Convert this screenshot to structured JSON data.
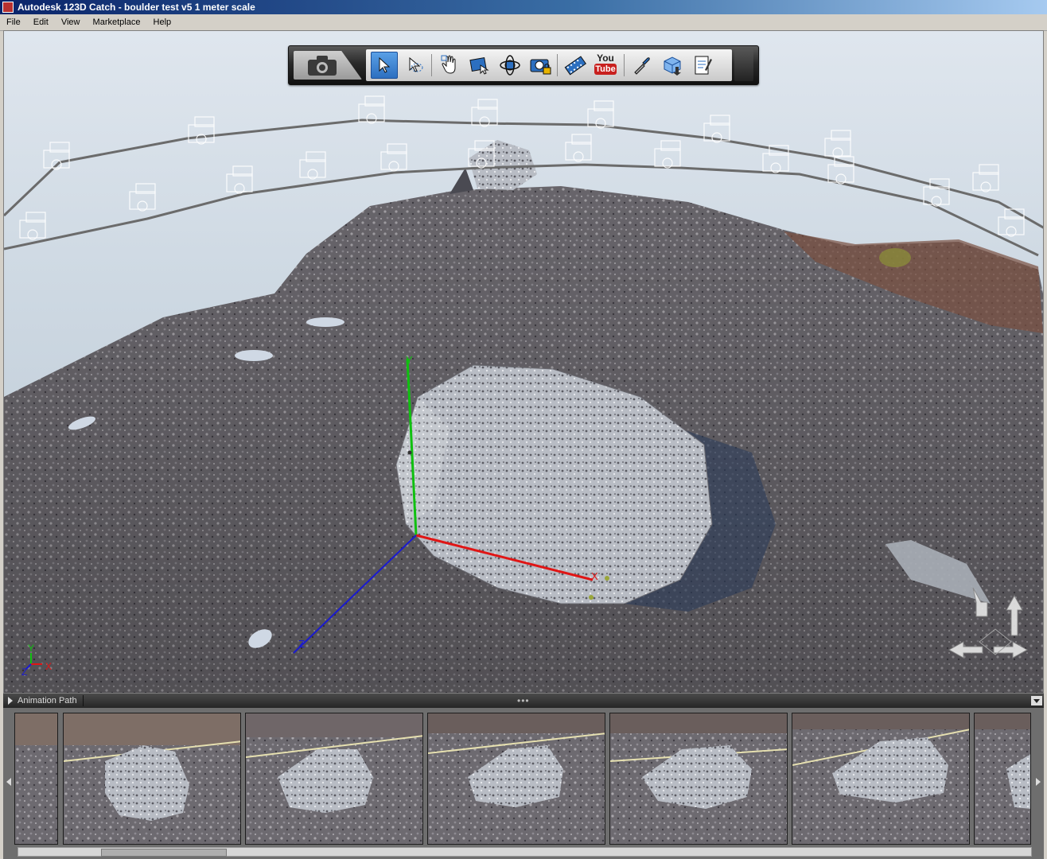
{
  "window": {
    "title": "Autodesk 123D Catch - boulder test v5 1 meter scale"
  },
  "menu": [
    {
      "label": "File"
    },
    {
      "label": "Edit"
    },
    {
      "label": "View"
    },
    {
      "label": "Marketplace"
    },
    {
      "label": "Help"
    }
  ],
  "toolbar": {
    "tools": [
      {
        "name": "select-icon"
      },
      {
        "name": "lasso-select-icon"
      },
      {
        "name": "pan-hand-icon"
      },
      {
        "name": "zoom-window-icon"
      },
      {
        "name": "orbit-icon"
      },
      {
        "name": "lock-camera-icon"
      },
      {
        "name": "film-strip-icon"
      },
      {
        "name": "youtube-icon",
        "you": "You",
        "tube": "Tube"
      },
      {
        "name": "eyedropper-icon"
      },
      {
        "name": "mesh-export-icon"
      },
      {
        "name": "report-icon"
      }
    ]
  },
  "viewport": {
    "axes": {
      "x": "X",
      "y": "Y",
      "z": "Z"
    },
    "mini_axes": {
      "x": "X",
      "y": "Y",
      "z": "Z"
    }
  },
  "animation_panel": {
    "label": "Animation Path",
    "grip": "•••"
  },
  "colors": {
    "axis_x": "#e01515",
    "axis_y": "#10c010",
    "axis_z": "#1a1ad0",
    "titlebar": "#0a246a"
  }
}
